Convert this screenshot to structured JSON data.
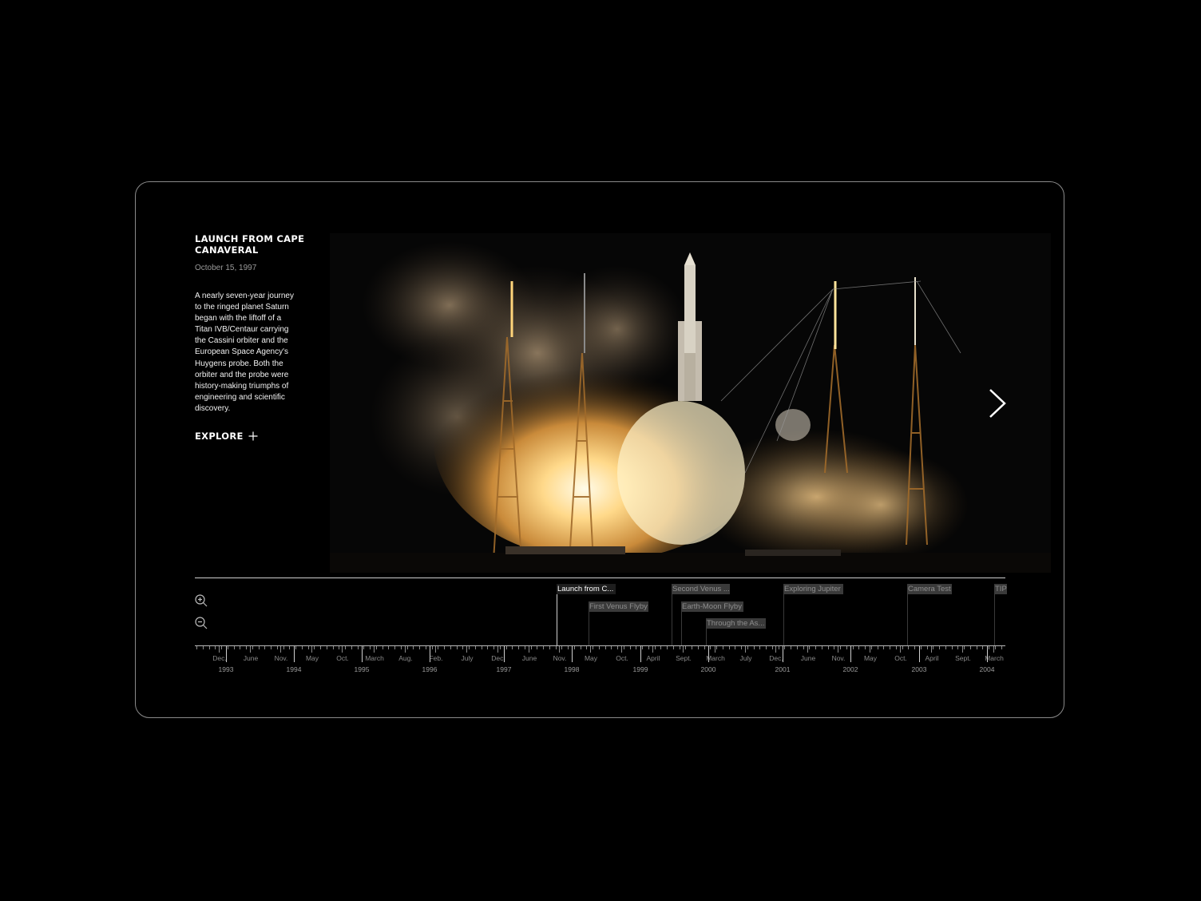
{
  "story": {
    "title": "Launch from Cape Canaveral",
    "date": "October 15, 1997",
    "description": "A nearly seven-year journey to the ringed planet Saturn began with the liftoff of a Titan IVB/Centaur carrying the Cassini orbiter and the European Space Agency's Huygens probe. Both the orbiter and the probe were history-making triumphs of engineering and scientific discovery.",
    "explore_label": "EXPLORE",
    "explore_icon": "plus-icon"
  },
  "media": {
    "image_subject": "rocket-launch-photo",
    "next_icon": "chevron-right-icon"
  },
  "timeline": {
    "zoom_in_icon": "zoom-in-icon",
    "zoom_out_icon": "zoom-out-icon",
    "events": [
      {
        "label": "Launch from C...",
        "active": true
      },
      {
        "label": "First Venus Flyby",
        "active": false
      },
      {
        "label": "Second Venus ...",
        "active": false
      },
      {
        "label": "Earth-Moon Flyby",
        "active": false
      },
      {
        "label": "Through the As...",
        "active": false
      },
      {
        "label": "Exploring Jupiter",
        "active": false
      },
      {
        "label": "Camera Test",
        "active": false
      },
      {
        "label": "TIP",
        "active": false
      }
    ],
    "month_labels": [
      "Dec.",
      "June",
      "Nov.",
      "May",
      "Oct.",
      "March",
      "Aug.",
      "Feb.",
      "July",
      "Dec.",
      "June",
      "Nov.",
      "May",
      "Oct.",
      "April",
      "Sept.",
      "March",
      "July",
      "Dec.",
      "June",
      "Nov.",
      "May",
      "Oct.",
      "April",
      "Sept.",
      "March"
    ],
    "year_labels": [
      "1993",
      "1994",
      "1995",
      "1996",
      "1997",
      "1998",
      "1999",
      "2000",
      "2001",
      "2002",
      "2003",
      "2004"
    ]
  },
  "colors": {
    "background": "#000000",
    "frame_border": "#8a8a8a",
    "active_event_bg": "#1e1e1e",
    "inactive_event_bg": "#3a3a3a",
    "muted_text": "#8a8a8a"
  }
}
